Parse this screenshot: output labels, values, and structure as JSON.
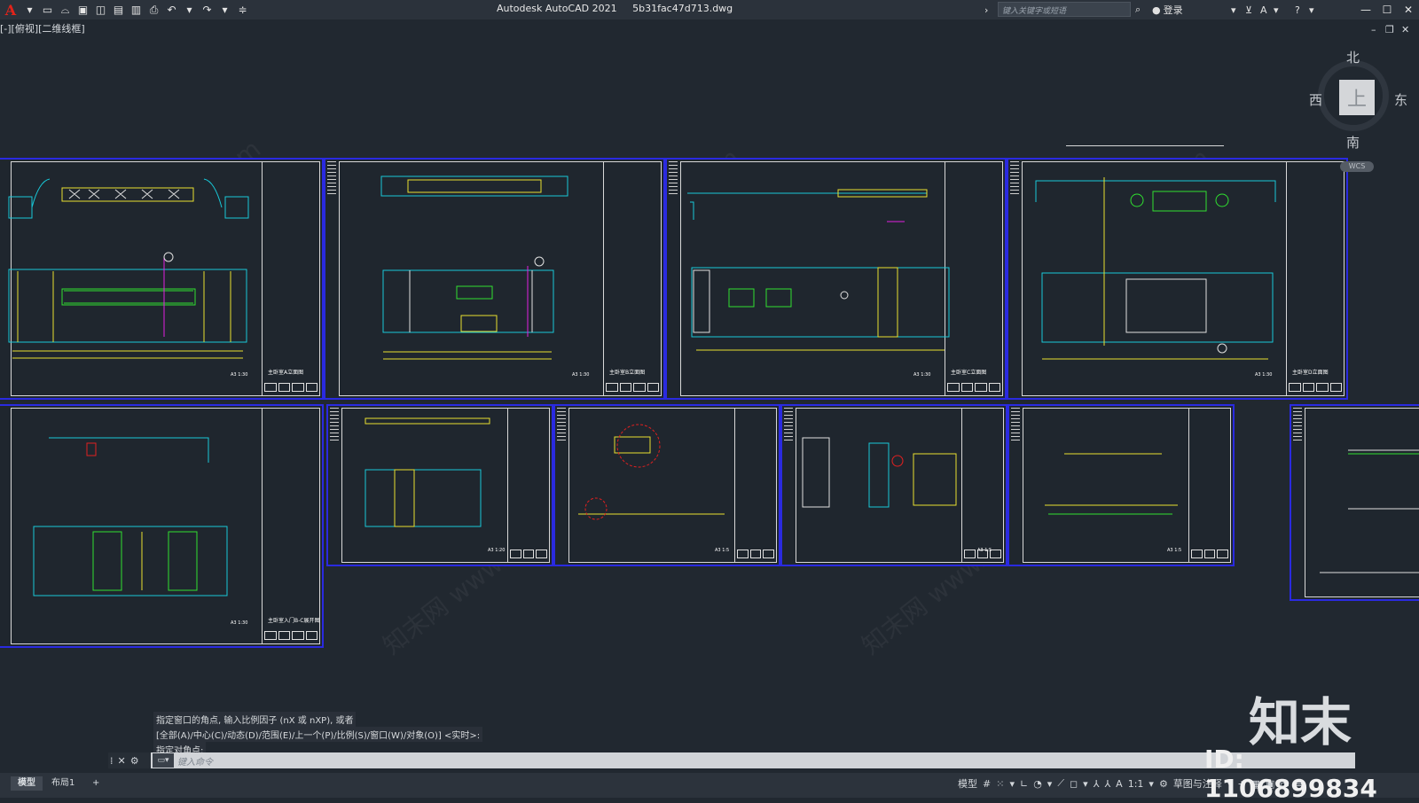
{
  "app": {
    "title": "Autodesk AutoCAD 2021",
    "filename": "5b31fac47d713.dwg",
    "logo": "A",
    "search_placeholder": "键入关键字或短语",
    "login_label": "登录"
  },
  "viewport": {
    "label": "[-][俯视][二维线框]"
  },
  "viewcube": {
    "north": "北",
    "south": "南",
    "east": "东",
    "west": "西",
    "top": "上",
    "wcs": "WCS"
  },
  "sheets": [
    {
      "name": "主卧室A立面图",
      "scale": "A3 1:30"
    },
    {
      "name": "主卧室B立面图",
      "scale": "A3 1:30"
    },
    {
      "name": "主卧室C立面图",
      "scale": "A3 1:30"
    },
    {
      "name": "主卧室D立面图",
      "scale": "A3 1:30"
    },
    {
      "name": "主卧室入门B-C展开图",
      "scale": "A3 1:30"
    },
    {
      "name": "",
      "scale": "A3 1:20"
    },
    {
      "name": "",
      "scale": "A3 1:5"
    },
    {
      "name": "",
      "scale": "A3 1:5"
    },
    {
      "name": "",
      "scale": "A3 1:5"
    },
    {
      "name": "",
      "scale": ""
    }
  ],
  "command": {
    "history": [
      "指定窗口的角点, 输入比例因子 (nX 或 nXP), 或者",
      "[全部(A)/中心(C)/动态(D)/范围(E)/上一个(P)/比例(S)/窗口(W)/对象(O)] <实时>:",
      "指定对角点:"
    ],
    "input_placeholder": "键入命令"
  },
  "layout_tabs": [
    {
      "label": "模型",
      "active": true
    },
    {
      "label": "布局1",
      "active": false
    }
  ],
  "status": {
    "model_label": "模型",
    "scale_label": "1:1",
    "workspace_label": "草图与注释"
  },
  "watermarks": [
    "www.znzmo.com",
    "知末网 www.znzmo.com"
  ],
  "brand": {
    "name": "知末",
    "id": "ID: 1106899834"
  },
  "colors": {
    "background": "#212830",
    "sheet_border": "#2a2ae0",
    "cyan": "#18c8d8",
    "yellow": "#e8e030",
    "green": "#30e030",
    "red": "#e02020",
    "magenta": "#e020e0"
  }
}
